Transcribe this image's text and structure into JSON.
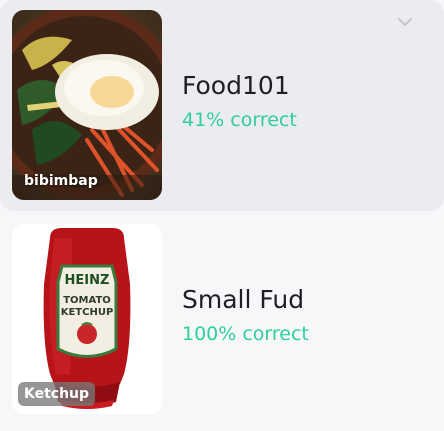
{
  "datasets": [
    {
      "name": "Food101",
      "score": "41% correct",
      "thumb_label": "bibimbap",
      "thumb_icon": "bibimbap-photo",
      "expanded_icon": "chevron-down-icon"
    },
    {
      "name": "Small Fud",
      "score": "100% correct",
      "thumb_label": "Ketchup",
      "thumb_icon": "ketchup-bottle-photo",
      "bottle_text": {
        "brand": "HEINZ",
        "line1": "TOMATO",
        "line2": "KETCHUP"
      }
    }
  ],
  "colors": {
    "accent": "#2fcf9c",
    "selected_bg": "#ebecef",
    "page_bg": "#f6f7f9"
  }
}
